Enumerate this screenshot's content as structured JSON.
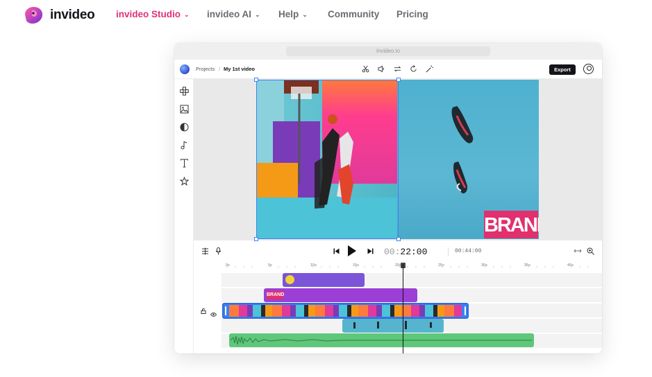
{
  "site_nav": {
    "brand": "invideo",
    "items": [
      {
        "label": "invideo Studio",
        "active": true,
        "dropdown": true
      },
      {
        "label": "invideo AI",
        "active": false,
        "dropdown": true
      },
      {
        "label": "Help",
        "active": false,
        "dropdown": true
      },
      {
        "label": "Community",
        "active": false,
        "dropdown": false
      },
      {
        "label": "Pricing",
        "active": false,
        "dropdown": false
      }
    ],
    "active_color": "#e0307a"
  },
  "browser": {
    "url": "invideo.io"
  },
  "editor": {
    "breadcrumb": {
      "root": "Projects",
      "separator": "/",
      "current": "My 1st video"
    },
    "header_tools": [
      "scissors-icon",
      "volume-icon",
      "swap-icon",
      "rotate-icon",
      "magic-wand-icon"
    ],
    "export_label": "Export",
    "left_rail": [
      "templates-icon",
      "media-icon",
      "shapes-icon",
      "music-icon",
      "text-icon",
      "star-icon"
    ],
    "preview": {
      "brand_text": "BRAND"
    },
    "timeline": {
      "current_time_prefix": "00:",
      "current_time_main": "22:00",
      "total_time": "00:44:00",
      "ruler_labels": [
        "0s",
        "5s",
        "10s",
        "15s",
        "20s",
        "25s",
        "30s",
        "35s",
        "40s"
      ],
      "tracks": [
        {
          "name": "sticker-track",
          "color": "#7c54d8"
        },
        {
          "name": "brand-text-track",
          "color": "#9b3fd6"
        },
        {
          "name": "video-track",
          "color": "#3b82f6"
        },
        {
          "name": "shoes-track",
          "color": "#56b4cf"
        },
        {
          "name": "audio-track",
          "color": "#5ec77a"
        }
      ]
    }
  }
}
